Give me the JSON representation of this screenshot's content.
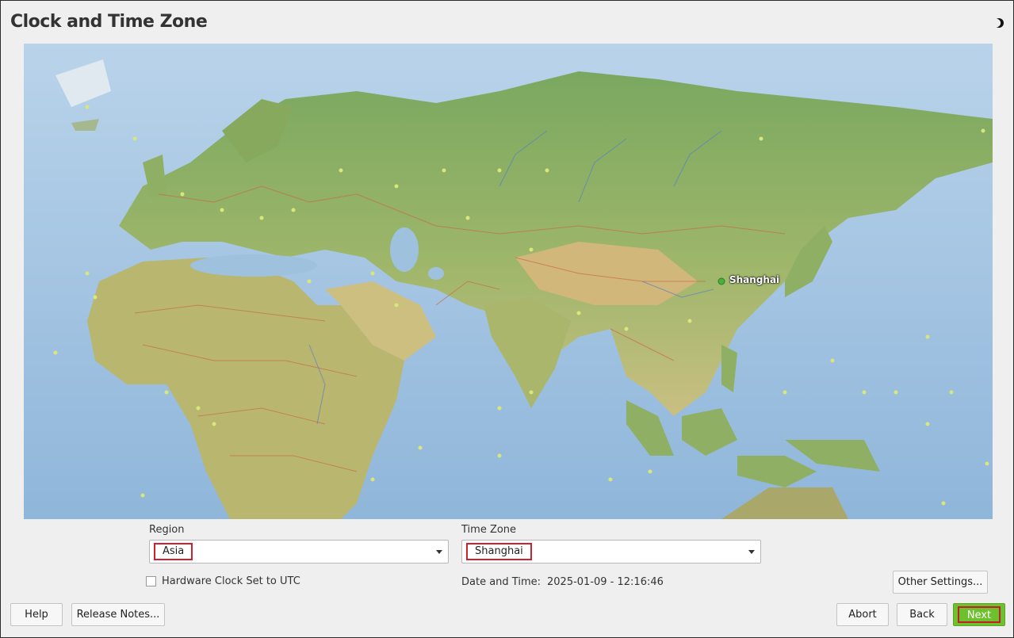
{
  "page": {
    "title": "Clock and Time Zone"
  },
  "icons": {
    "theme": "half-moon-icon"
  },
  "map": {
    "selected_city": "Shanghai",
    "selected_region": "Asia"
  },
  "region": {
    "label": "Region",
    "value": "Asia"
  },
  "timezone": {
    "label": "Time Zone",
    "value": "Shanghai"
  },
  "hardware_clock": {
    "label": "Hardware Clock Set to UTC",
    "checked": false
  },
  "datetime": {
    "label": "Date and Time:",
    "value": "2025-01-09 - 12:16:46"
  },
  "buttons": {
    "other_settings": "Other Settings...",
    "help": "Help",
    "release_notes": "Release Notes...",
    "abort": "Abort",
    "back": "Back",
    "next": "Next"
  },
  "colors": {
    "accent": "#6fc02e",
    "highlight_border": "#d02030"
  }
}
